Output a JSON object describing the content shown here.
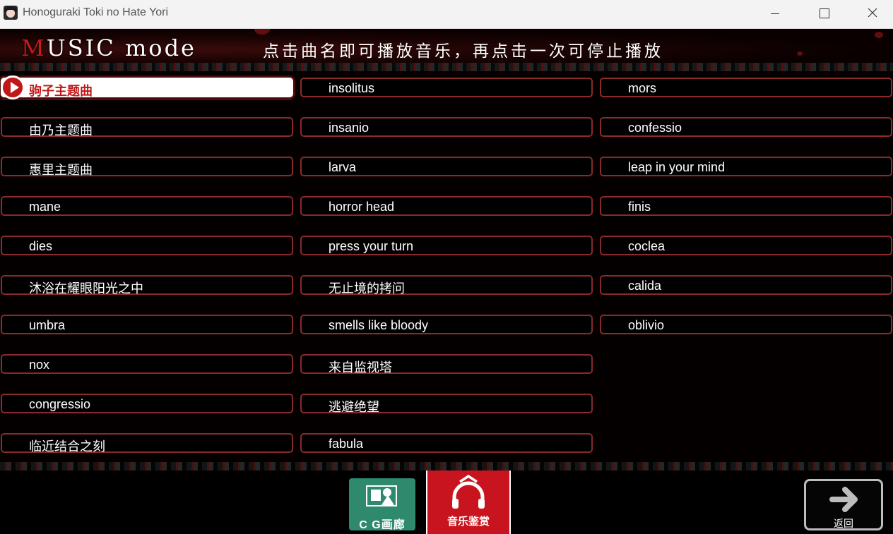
{
  "window": {
    "title": "Honoguraki Toki no Hate Yori"
  },
  "header": {
    "title_first": "M",
    "title_rest": "USIC mode",
    "instruction": "点击曲名即可播放音乐，再点击一次可停止播放"
  },
  "tracks": {
    "col1": [
      "驹子主题曲",
      "由乃主题曲",
      "惠里主题曲",
      "mane",
      "dies",
      "沐浴在耀眼阳光之中",
      "umbra",
      "nox",
      "congressio",
      "临近结合之刻"
    ],
    "col2": [
      "insolitus",
      "insanio",
      "larva",
      "horror head",
      "press your turn",
      "无止境的拷问",
      "smells like bloody",
      "来自监视塔",
      "逃避绝望",
      "fabula"
    ],
    "col3": [
      "mors",
      "confessio",
      "leap in your mind",
      "finis",
      "coclea",
      "calida",
      "oblivio"
    ],
    "selected": "驹子主题曲"
  },
  "nav": {
    "cg_label": "C G画廊",
    "music_label": "音乐鉴赏",
    "back_label": "返回"
  },
  "colors": {
    "accent_red": "#c8141e",
    "cg_green": "#2f8a6d",
    "border_red": "#8a2a2a"
  }
}
